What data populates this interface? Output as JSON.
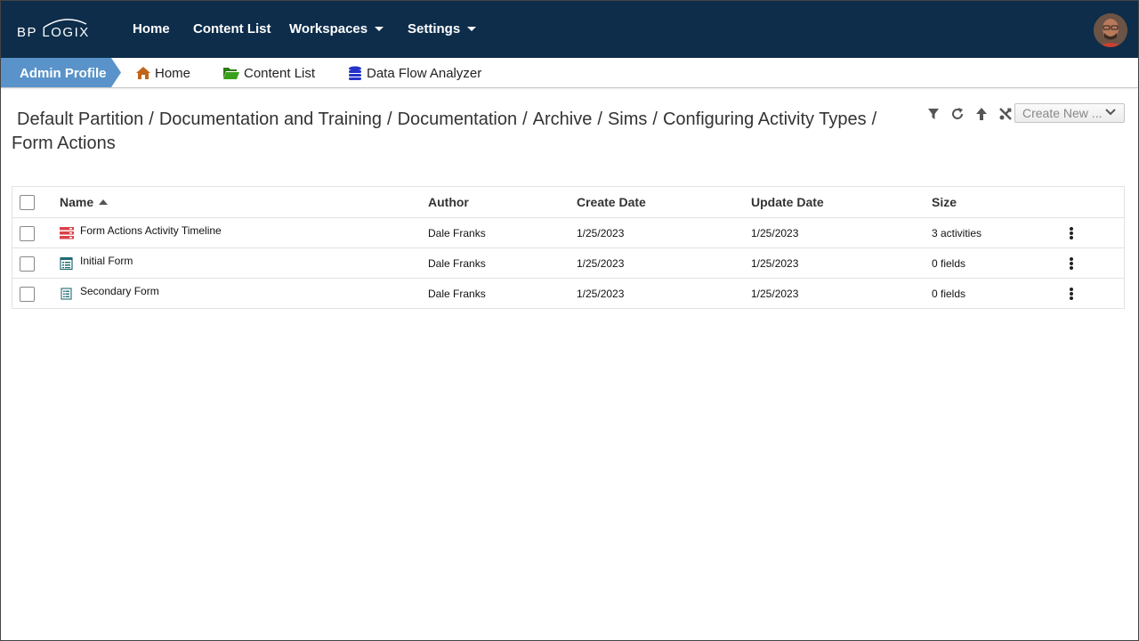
{
  "brand": {
    "logo_text": "BP LOGIX"
  },
  "topnav": {
    "items": [
      {
        "label": "Home"
      },
      {
        "label": "Content List"
      },
      {
        "label": "Workspaces"
      },
      {
        "label": "Settings"
      }
    ]
  },
  "subbar": {
    "profile": "Admin Profile",
    "items": [
      {
        "label": "Home"
      },
      {
        "label": "Content List"
      },
      {
        "label": "Data Flow Analyzer"
      }
    ]
  },
  "breadcrumb": {
    "segments": [
      "Default Partition",
      "Documentation and Training",
      "Documentation",
      "Archive",
      "Sims",
      "Configuring Activity Types",
      "Form Actions"
    ],
    "separator": "/"
  },
  "toolbar": {
    "create_new": "Create New ..."
  },
  "table": {
    "columns": [
      "Name",
      "Author",
      "Create Date",
      "Update Date",
      "Size"
    ],
    "rows": [
      {
        "name": "Form Actions Activity Timeline",
        "author": "Dale Franks",
        "create_date": "1/25/2023",
        "update_date": "1/25/2023",
        "size": "3 activities",
        "icon": "timeline-icon"
      },
      {
        "name": "Initial Form",
        "author": "Dale Franks",
        "create_date": "1/25/2023",
        "update_date": "1/25/2023",
        "size": "0 fields",
        "icon": "form-icon"
      },
      {
        "name": "Secondary Form",
        "author": "Dale Franks",
        "create_date": "1/25/2023",
        "update_date": "1/25/2023",
        "size": "0 fields",
        "icon": "form-icon"
      }
    ]
  },
  "colors": {
    "topnav_bg": "#0d2d4a",
    "profile_tab": "#5a93c9",
    "home_icon": "#c0651a",
    "folder_icon": "#3a8f1c",
    "dataflow_icon": "#2433c8",
    "timeline_icon": "#d9434a",
    "form_icon": "#1f6b73"
  }
}
